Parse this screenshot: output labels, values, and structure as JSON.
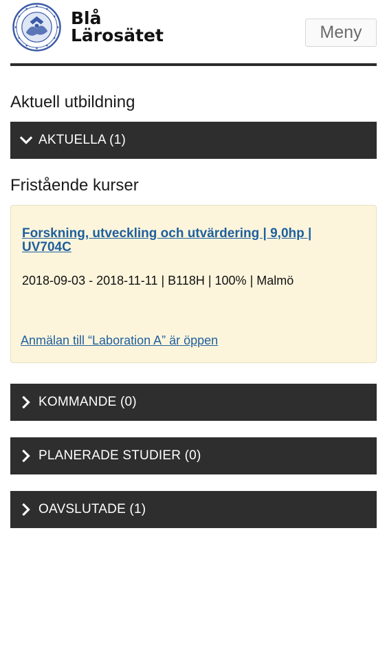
{
  "header": {
    "logo_line1": "Blå",
    "logo_line2": "Lärosätet",
    "menu_label": "Meny"
  },
  "current_education": {
    "heading": "Aktuell utbildning",
    "current_label": "AKTUELLA (1)",
    "free_courses_heading": "Fristående kurser",
    "course": {
      "title": "Forskning, utveckling och utvärdering | 9,0hp | UV704C",
      "meta": "2018-09-03 - 2018-11-11 | B118H | 100% | Malmö",
      "notice_link": "Anmälan till “Laboration A” är öppen"
    }
  },
  "sections": [
    {
      "label": "KOMMANDE (0)"
    },
    {
      "label": "PLANERADE STUDIER (0)"
    },
    {
      "label": "OAVSLUTADE (1)"
    }
  ],
  "colors": {
    "bar_background": "#2e2e2e",
    "card_background": "#fcf5dc",
    "link": "#1f5f9c"
  },
  "icons": {
    "logo": "university-seal-icon",
    "expanded": "chevron-down-icon",
    "collapsed": "chevron-right-icon"
  }
}
